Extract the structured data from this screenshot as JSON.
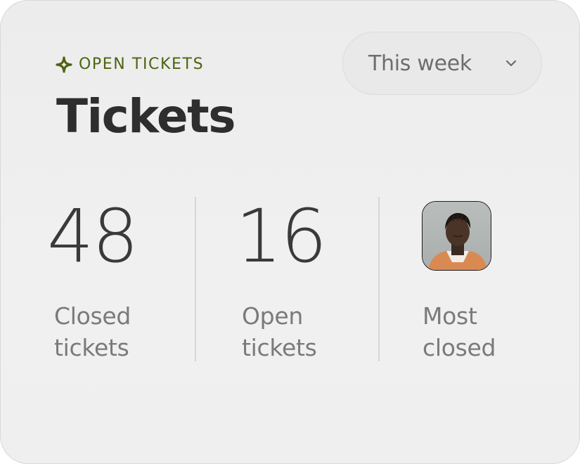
{
  "widget": {
    "eyebrow_icon": "sparkle-icon",
    "eyebrow": "OPEN TICKETS",
    "title": "Tickets",
    "accent_color": "#4d6311"
  },
  "period_select": {
    "value": "This week",
    "icon": "chevron-down-icon"
  },
  "stats": {
    "closed": {
      "value": "48",
      "label_line1": "Closed",
      "label_line2": "tickets"
    },
    "open": {
      "value": "16",
      "label_line1": "Open",
      "label_line2": "tickets"
    },
    "most_closed": {
      "label_line1": "Most",
      "label_line2": "closed",
      "avatar": "user-avatar-photo"
    }
  }
}
